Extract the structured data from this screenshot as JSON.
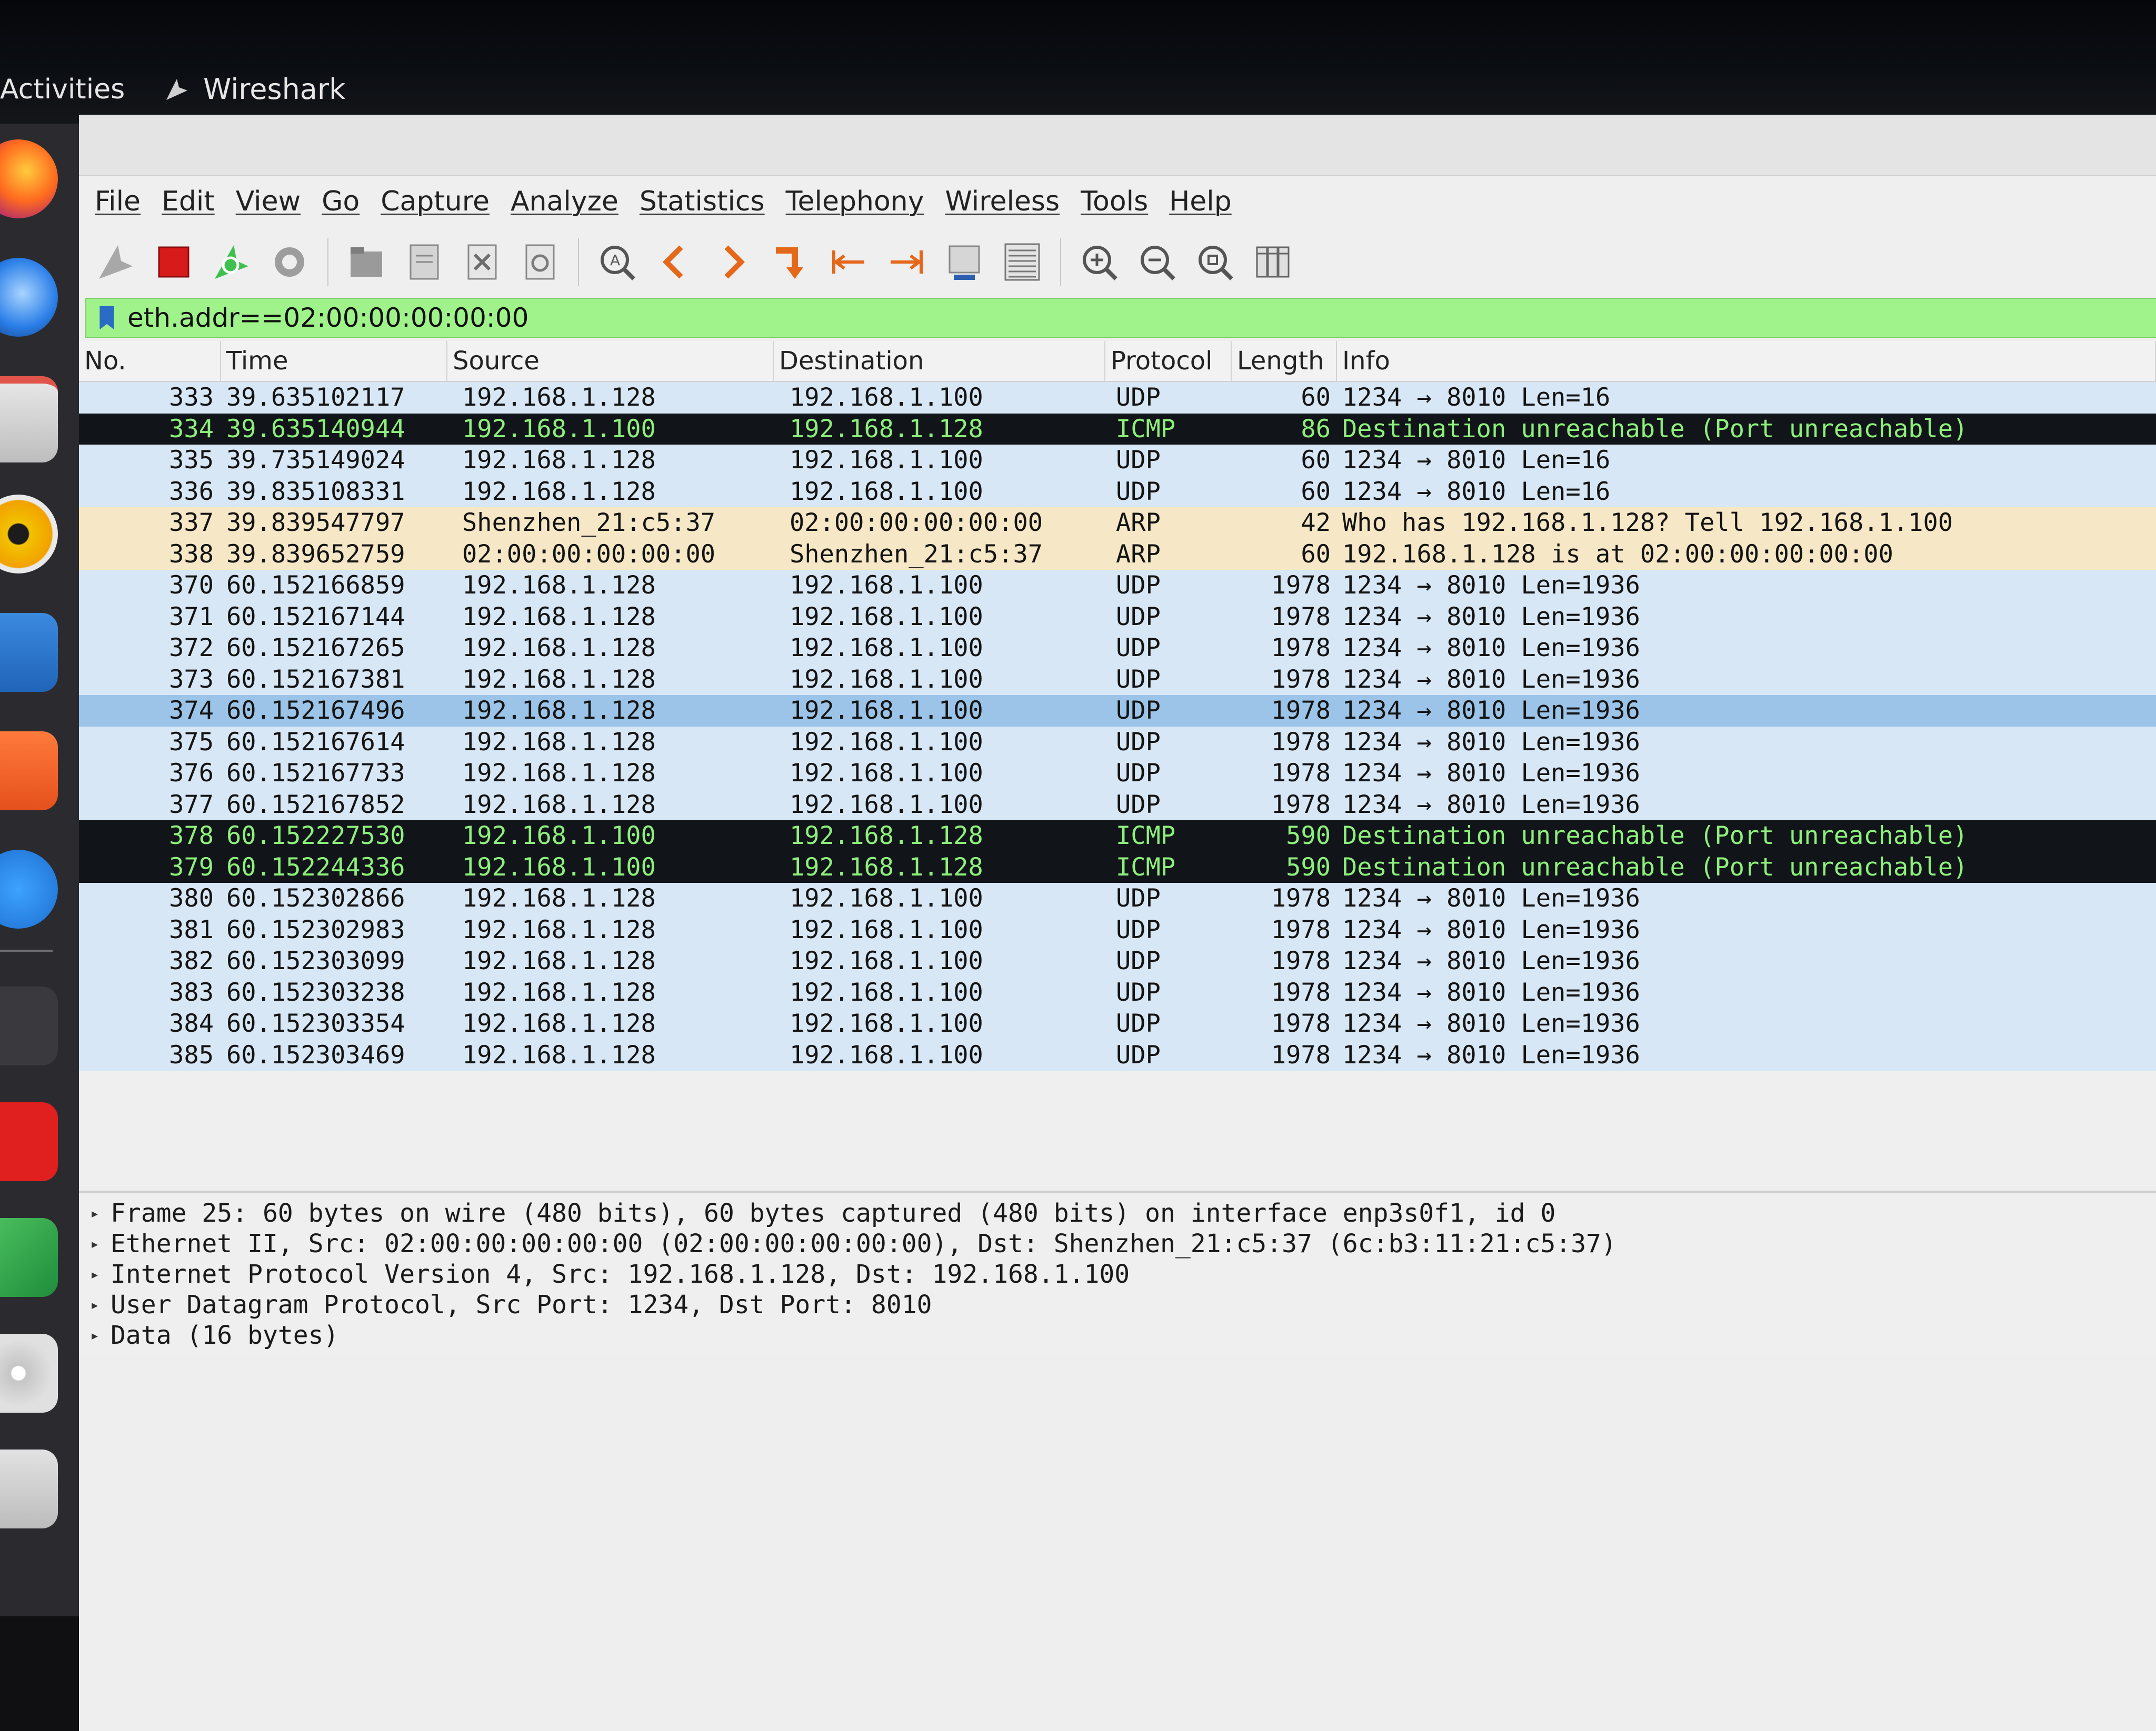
{
  "system": {
    "activities_label": "Activities",
    "app_name": "Wireshark"
  },
  "menu": [
    "File",
    "Edit",
    "View",
    "Go",
    "Capture",
    "Analyze",
    "Statistics",
    "Telephony",
    "Wireless",
    "Tools",
    "Help"
  ],
  "filter": {
    "value": "eth.addr==02:00:00:00:00:00"
  },
  "columns": {
    "no": "No.",
    "time": "Time",
    "source": "Source",
    "destination": "Destination",
    "protocol": "Protocol",
    "length": "Length",
    "info": "Info"
  },
  "packets": [
    {
      "no": "333",
      "time": "39.635102117",
      "source": "192.168.1.128",
      "destination": "192.168.1.100",
      "protocol": "UDP",
      "length": "60",
      "info": "1234 → 8010 Len=16"
    },
    {
      "no": "334",
      "time": "39.635140944",
      "source": "192.168.1.100",
      "destination": "192.168.1.128",
      "protocol": "ICMP",
      "length": "86",
      "info": "Destination unreachable (Port unreachable)"
    },
    {
      "no": "335",
      "time": "39.735149024",
      "source": "192.168.1.128",
      "destination": "192.168.1.100",
      "protocol": "UDP",
      "length": "60",
      "info": "1234 → 8010 Len=16"
    },
    {
      "no": "336",
      "time": "39.835108331",
      "source": "192.168.1.128",
      "destination": "192.168.1.100",
      "protocol": "UDP",
      "length": "60",
      "info": "1234 → 8010 Len=16"
    },
    {
      "no": "337",
      "time": "39.839547797",
      "source": "Shenzhen_21:c5:37",
      "destination": "02:00:00:00:00:00",
      "protocol": "ARP",
      "length": "42",
      "info": "Who has 192.168.1.128? Tell 192.168.1.100"
    },
    {
      "no": "338",
      "time": "39.839652759",
      "source": "02:00:00:00:00:00",
      "destination": "Shenzhen_21:c5:37",
      "protocol": "ARP",
      "length": "60",
      "info": "192.168.1.128 is at 02:00:00:00:00:00"
    },
    {
      "no": "370",
      "time": "60.152166859",
      "source": "192.168.1.128",
      "destination": "192.168.1.100",
      "protocol": "UDP",
      "length": "1978",
      "info": "1234 → 8010 Len=1936"
    },
    {
      "no": "371",
      "time": "60.152167144",
      "source": "192.168.1.128",
      "destination": "192.168.1.100",
      "protocol": "UDP",
      "length": "1978",
      "info": "1234 → 8010 Len=1936"
    },
    {
      "no": "372",
      "time": "60.152167265",
      "source": "192.168.1.128",
      "destination": "192.168.1.100",
      "protocol": "UDP",
      "length": "1978",
      "info": "1234 → 8010 Len=1936"
    },
    {
      "no": "373",
      "time": "60.152167381",
      "source": "192.168.1.128",
      "destination": "192.168.1.100",
      "protocol": "UDP",
      "length": "1978",
      "info": "1234 → 8010 Len=1936"
    },
    {
      "no": "374",
      "time": "60.152167496",
      "source": "192.168.1.128",
      "destination": "192.168.1.100",
      "protocol": "UDP",
      "length": "1978",
      "info": "1234 → 8010 Len=1936"
    },
    {
      "no": "375",
      "time": "60.152167614",
      "source": "192.168.1.128",
      "destination": "192.168.1.100",
      "protocol": "UDP",
      "length": "1978",
      "info": "1234 → 8010 Len=1936"
    },
    {
      "no": "376",
      "time": "60.152167733",
      "source": "192.168.1.128",
      "destination": "192.168.1.100",
      "protocol": "UDP",
      "length": "1978",
      "info": "1234 → 8010 Len=1936"
    },
    {
      "no": "377",
      "time": "60.152167852",
      "source": "192.168.1.128",
      "destination": "192.168.1.100",
      "protocol": "UDP",
      "length": "1978",
      "info": "1234 → 8010 Len=1936"
    },
    {
      "no": "378",
      "time": "60.152227530",
      "source": "192.168.1.100",
      "destination": "192.168.1.128",
      "protocol": "ICMP",
      "length": "590",
      "info": "Destination unreachable (Port unreachable)"
    },
    {
      "no": "379",
      "time": "60.152244336",
      "source": "192.168.1.100",
      "destination": "192.168.1.128",
      "protocol": "ICMP",
      "length": "590",
      "info": "Destination unreachable (Port unreachable)"
    },
    {
      "no": "380",
      "time": "60.152302866",
      "source": "192.168.1.128",
      "destination": "192.168.1.100",
      "protocol": "UDP",
      "length": "1978",
      "info": "1234 → 8010 Len=1936"
    },
    {
      "no": "381",
      "time": "60.152302983",
      "source": "192.168.1.128",
      "destination": "192.168.1.100",
      "protocol": "UDP",
      "length": "1978",
      "info": "1234 → 8010 Len=1936"
    },
    {
      "no": "382",
      "time": "60.152303099",
      "source": "192.168.1.128",
      "destination": "192.168.1.100",
      "protocol": "UDP",
      "length": "1978",
      "info": "1234 → 8010 Len=1936"
    },
    {
      "no": "383",
      "time": "60.152303238",
      "source": "192.168.1.128",
      "destination": "192.168.1.100",
      "protocol": "UDP",
      "length": "1978",
      "info": "1234 → 8010 Len=1936"
    },
    {
      "no": "384",
      "time": "60.152303354",
      "source": "192.168.1.128",
      "destination": "192.168.1.100",
      "protocol": "UDP",
      "length": "1978",
      "info": "1234 → 8010 Len=1936"
    },
    {
      "no": "385",
      "time": "60.152303469",
      "source": "192.168.1.128",
      "destination": "192.168.1.100",
      "protocol": "UDP",
      "length": "1978",
      "info": "1234 → 8010 Len=1936"
    }
  ],
  "selected_packet": "374",
  "details": [
    "Frame 25: 60 bytes on wire (480 bits), 60 bytes captured (480 bits) on interface enp3s0f1, id 0",
    "Ethernet II, Src: 02:00:00:00:00:00 (02:00:00:00:00:00), Dst: Shenzhen_21:c5:37 (6c:b3:11:21:c5:37)",
    "Internet Protocol Version 4, Src: 192.168.1.128, Dst: 192.168.1.100",
    "User Datagram Protocol, Src Port: 1234, Dst Port: 8010",
    "Data (16 bytes)"
  ],
  "colors": {
    "udp_row": "#d8e7f5",
    "arp_row": "#f6e8c6",
    "icmp_row_bg": "#111418",
    "icmp_row_fg": "#8df07c",
    "selected_row": "#9cc4e8",
    "filter_valid": "#9ff38a"
  },
  "icons": {
    "dock": [
      "firefox-icon",
      "thunderbird-icon",
      "files-icon",
      "rhythmbox-icon",
      "writer-icon",
      "software-center-icon",
      "help-icon",
      "terminal-icon",
      "red-app-icon",
      "wireshark-icon",
      "optical-drive-icon",
      "trash-icon"
    ],
    "toolbar": [
      "start-capture-icon",
      "stop-capture-icon",
      "restart-capture-icon",
      "capture-options-icon",
      "open-file-icon",
      "save-file-icon",
      "close-file-icon",
      "reload-file-icon",
      "find-packet-icon",
      "go-back-icon",
      "go-forward-icon",
      "go-to-packet-icon",
      "first-packet-icon",
      "last-packet-icon",
      "autoscroll-icon",
      "colorize-icon",
      "zoom-in-icon",
      "zoom-out-icon",
      "normal-size-icon",
      "resize-columns-icon"
    ]
  }
}
